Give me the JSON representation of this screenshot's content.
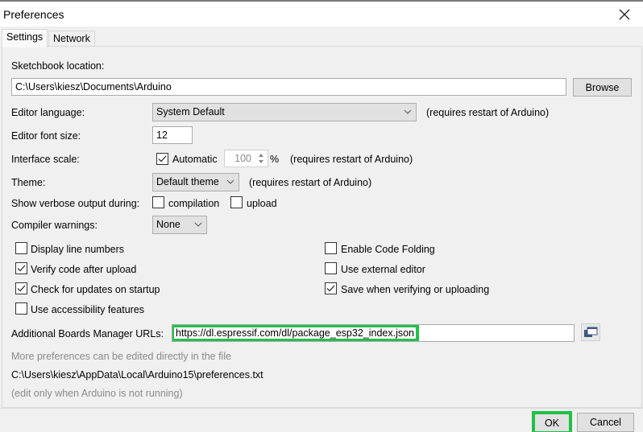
{
  "window": {
    "title": "Preferences",
    "close_icon": "close-icon"
  },
  "tabs": [
    {
      "label": "Settings",
      "active": true
    },
    {
      "label": "Network",
      "active": false
    }
  ],
  "settings": {
    "sketchbook": {
      "label": "Sketchbook location:",
      "value": "C:\\Users\\kiesz\\Documents\\Arduino",
      "browse_label": "Browse"
    },
    "editor_language": {
      "label": "Editor language:",
      "value": "System Default",
      "note": "(requires restart of Arduino)"
    },
    "editor_font_size": {
      "label": "Editor font size:",
      "value": "12"
    },
    "interface_scale": {
      "label": "Interface scale:",
      "automatic_label": "Automatic",
      "automatic_checked": true,
      "value": "100",
      "unit": "%",
      "note": "(requires restart of Arduino)"
    },
    "theme": {
      "label": "Theme:",
      "value": "Default theme",
      "note": "(requires restart of Arduino)"
    },
    "verbose": {
      "label": "Show verbose output during:",
      "compilation_label": "compilation",
      "compilation_checked": false,
      "upload_label": "upload",
      "upload_checked": false
    },
    "compiler_warnings": {
      "label": "Compiler warnings:",
      "value": "None"
    },
    "checkboxes_left": [
      {
        "label": "Display line numbers",
        "checked": false
      },
      {
        "label": "Verify code after upload",
        "checked": true
      },
      {
        "label": "Check for updates on startup",
        "checked": true
      },
      {
        "label": "Use accessibility features",
        "checked": false
      }
    ],
    "checkboxes_right": [
      {
        "label": "Enable Code Folding",
        "checked": false
      },
      {
        "label": "Use external editor",
        "checked": false
      },
      {
        "label": "Save when verifying or uploading",
        "checked": true
      }
    ],
    "boards_urls": {
      "label": "Additional Boards Manager URLs:",
      "value": "https://dl.espressif.com/dl/package_esp32_index.json",
      "edit_icon": "window-list-icon"
    },
    "more_prefs_note": "More preferences can be edited directly in the file",
    "prefs_path": "C:\\Users\\kiesz\\AppData\\Local\\Arduino15\\preferences.txt",
    "edit_note": "(edit only when Arduino is not running)"
  },
  "footer": {
    "ok_label": "OK",
    "cancel_label": "Cancel"
  },
  "highlight_color": "#22c04a"
}
